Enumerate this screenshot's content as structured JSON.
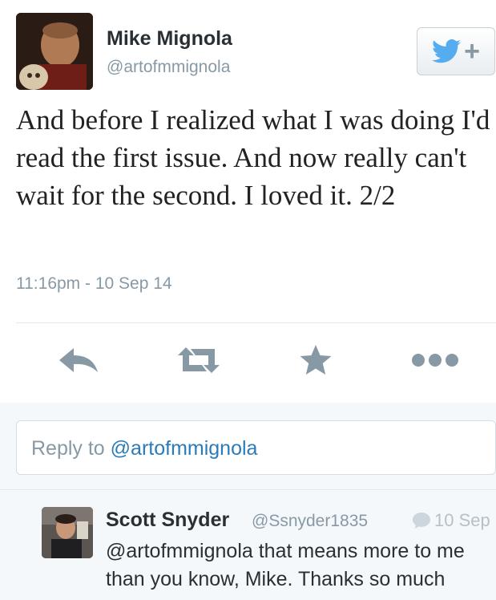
{
  "tweet": {
    "author_name": "Mike Mignola",
    "author_handle": "@artofmmignola",
    "text": "And before I realized what I was doing I'd read the first issue. And now really can't wait for the second. I loved it. 2/2",
    "timestamp": "11:16pm - 10 Sep 14"
  },
  "follow_button": {
    "icon": "twitter-bird-icon",
    "label": "+"
  },
  "actions": [
    {
      "name": "reply",
      "icon": "reply-icon"
    },
    {
      "name": "retweet",
      "icon": "retweet-icon"
    },
    {
      "name": "favorite",
      "icon": "star-icon"
    },
    {
      "name": "more",
      "icon": "more-icon"
    }
  ],
  "reply_input": {
    "prefix": "Reply to ",
    "mention": "@artofmmignola"
  },
  "replies": [
    {
      "author_name": "Scott Snyder",
      "author_handle": "@Ssnyder1835",
      "date": "10 Sep",
      "text": "@artofmmignola that means more to me than you know, Mike. Thanks so much"
    }
  ],
  "colors": {
    "accent": "#2b7bb9",
    "muted": "#8899a6",
    "twitter_blue": "#55acee"
  }
}
